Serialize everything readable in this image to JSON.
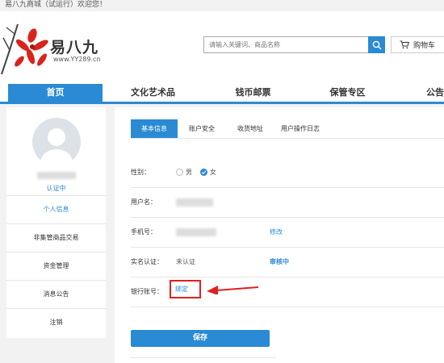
{
  "topbar": {
    "welcome": "易八九商城（试运行）欢迎您！"
  },
  "header": {
    "logo_name": "易八九",
    "logo_url": "www.YY289.cn",
    "search_placeholder": "请输入关键词、商品名称",
    "cart_label": "购物车"
  },
  "nav": {
    "items": [
      {
        "label": "首页"
      },
      {
        "label": "文化艺术品"
      },
      {
        "label": "钱币邮票"
      },
      {
        "label": "保管专区"
      },
      {
        "label": "公告"
      }
    ]
  },
  "sidebar": {
    "status": "认证中",
    "items": [
      {
        "label": "个人信息"
      },
      {
        "label": "非集管商品交易"
      },
      {
        "label": "资金管理"
      },
      {
        "label": "消息公告"
      },
      {
        "label": "注销"
      }
    ]
  },
  "main": {
    "tabs": [
      {
        "label": "基本信息"
      },
      {
        "label": "账户安全"
      },
      {
        "label": "收货地址"
      },
      {
        "label": "用户操作日志"
      }
    ],
    "gender": {
      "label": "性别：",
      "male": "男",
      "female": "女",
      "selected": "女"
    },
    "username": {
      "label": "用户名："
    },
    "phone": {
      "label": "手机号：",
      "action": "修改"
    },
    "realname": {
      "label": "实名认证：",
      "value": "未认证",
      "status": "审核中"
    },
    "bank": {
      "label": "银行账号：",
      "action": "绑定"
    },
    "save_label": "保存"
  },
  "colors": {
    "accent": "#2a8ad4",
    "highlight": "#e02020"
  }
}
